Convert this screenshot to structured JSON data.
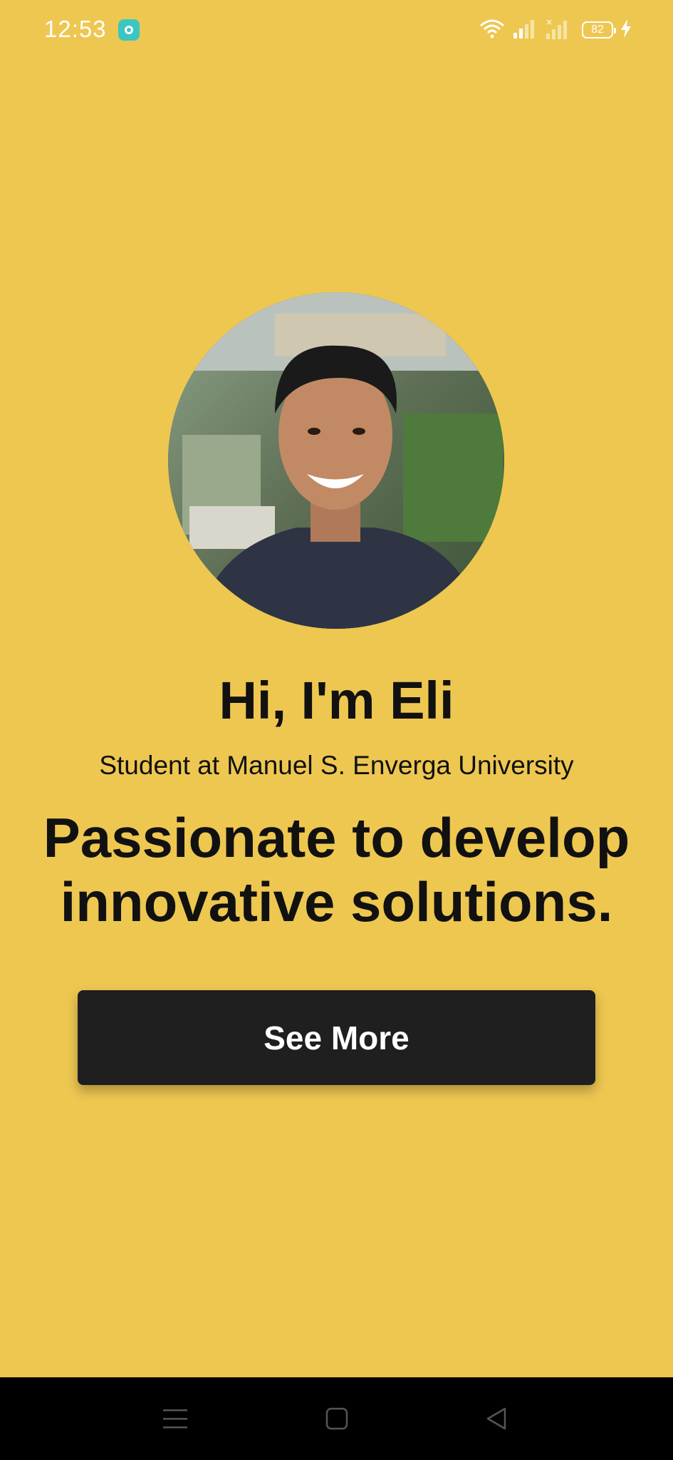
{
  "status_bar": {
    "time": "12:53",
    "battery_level": "82",
    "icons": [
      "app-notification-icon",
      "wifi-icon",
      "signal-icon",
      "signal-no-service-icon",
      "battery-icon",
      "charging-bolt-icon"
    ]
  },
  "profile": {
    "avatar_alt": "Profile photo",
    "greeting": "Hi, I'm Eli",
    "subtitle": "Student at Manuel S. Enverga University",
    "tagline": "Passionate to develop innovative solutions."
  },
  "actions": {
    "see_more_label": "See More"
  },
  "navigation": {
    "icons": [
      "menu-icon",
      "home-icon",
      "back-icon"
    ]
  },
  "colors": {
    "background": "#eec751",
    "button": "#1f1f1f",
    "text": "#111111"
  }
}
